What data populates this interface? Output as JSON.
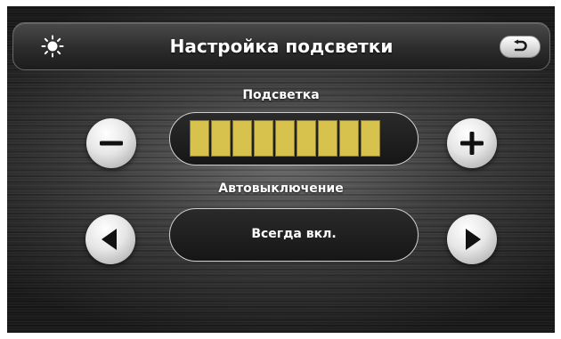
{
  "header": {
    "title": "Настройка подсветки",
    "icon": "sun-icon",
    "back_icon": "back-arrow-icon"
  },
  "backlight": {
    "label": "Подсветка",
    "level": 9,
    "max_level": 9,
    "bar_color": "#d8c24e",
    "decrease_icon": "minus-icon",
    "increase_icon": "plus-icon"
  },
  "auto_off": {
    "label": "Автовыключение",
    "value": "Всегда вкл.",
    "prev_icon": "triangle-left-icon",
    "next_icon": "triangle-right-icon"
  }
}
